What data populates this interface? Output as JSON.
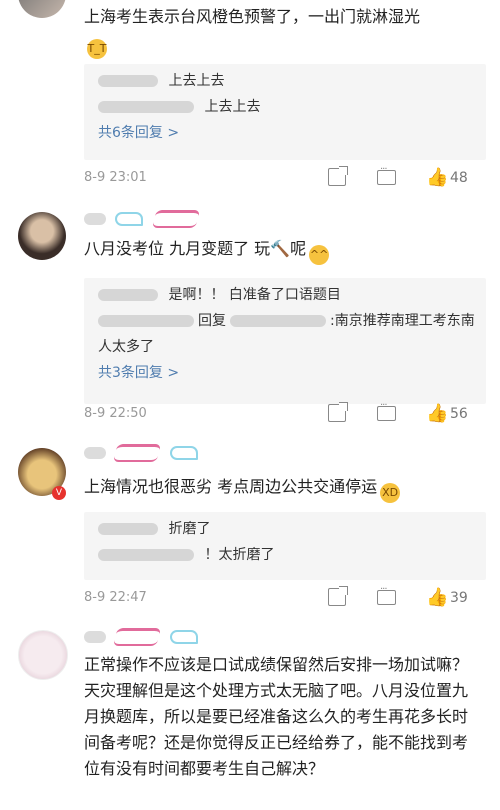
{
  "comments": [
    {
      "text": "上海考生表示台风橙色预警了，一出门就淋湿光",
      "emoji": "😭",
      "replies": [
        "上去上去",
        "上去上去"
      ],
      "more_label": "共6条回复 >",
      "date": "8-9 23:01",
      "likes": "48"
    },
    {
      "text": "八月没考位 九月变题了 玩🔨呢",
      "emoji": "😅",
      "replies": [
        "是啊！！ 白准备了口语题目",
        "回复",
        ":南京推荐南理工考东南人太多了"
      ],
      "more_label": "共3条回复 >",
      "date": "8-9 22:50",
      "likes": "56"
    },
    {
      "text": "上海情况也很恶劣 考点周边公共交通停运",
      "emoji": "😂",
      "replies": [
        "折磨了",
        "！太折磨了"
      ],
      "date": "8-9 22:47",
      "likes": "39"
    },
    {
      "text": "正常操作不应该是口试成绩保留然后安排一场加试嘛？ 天灾理解但是这个处理方式太无脑了吧。八月没位置九月换题库，所以是要已经准备这么久的考生再花多长时间备考呢？还是你觉得反正已经给券了，能不能找到考位有没有时间都要考生自己解决？"
    }
  ],
  "icons": {
    "share": "share-icon",
    "comment": "comment-icon",
    "like": "like-icon",
    "badge": "verified-badge-icon"
  },
  "colors": {
    "link": "#507daf",
    "meta": "#999999",
    "reply_bg": "#f5f5f5"
  }
}
